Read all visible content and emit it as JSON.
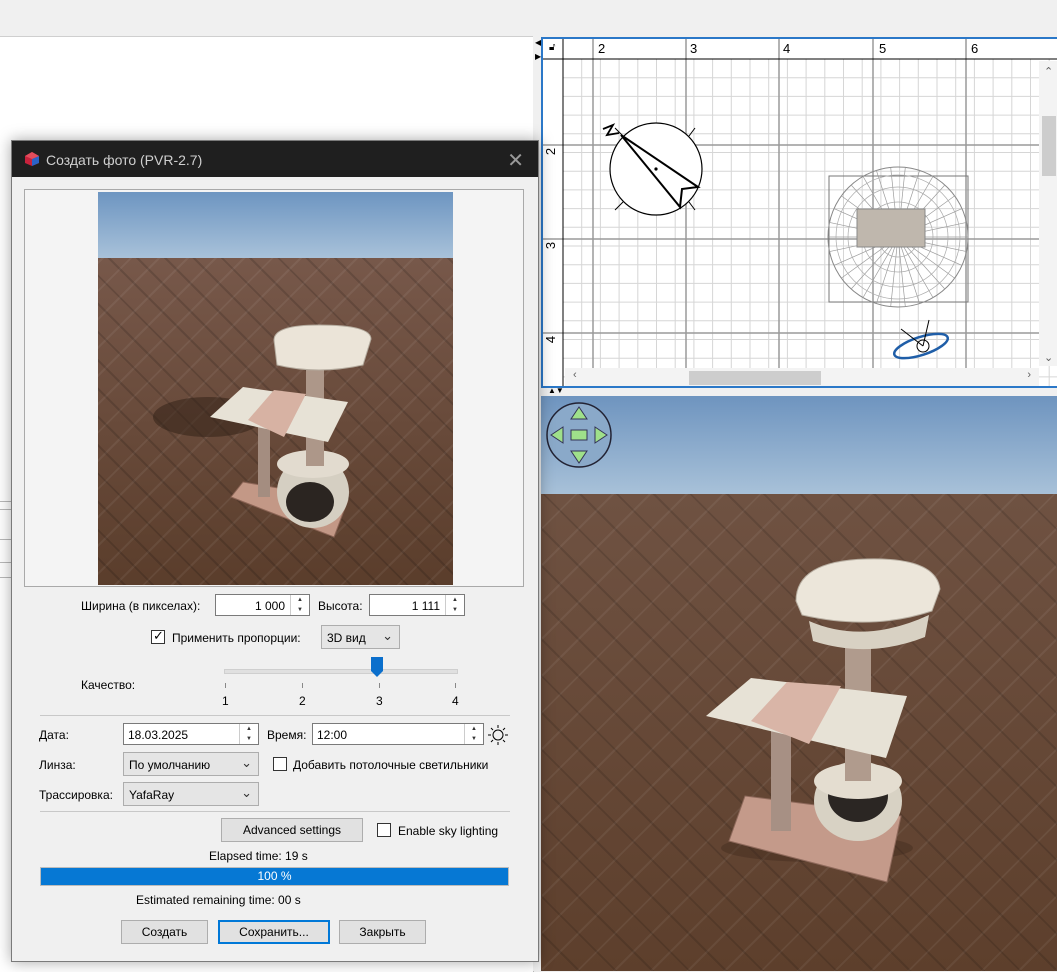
{
  "dialog": {
    "title": "Создать фото (PVR-2.7)",
    "width_label": "Ширина (в пикселах):",
    "width_value": "1 000",
    "height_label": "Высота:",
    "height_value": "1 111",
    "proportions_label": "Применить пропорции:",
    "proportions_checked": true,
    "view_mode": "3D вид",
    "quality_label": "Качество:",
    "quality_ticks": [
      "1",
      "2",
      "3",
      "4"
    ],
    "quality_value": 3,
    "date_label": "Дата:",
    "date_value": "18.03.2025",
    "time_label": "Время:",
    "time_value": "12:00",
    "lens_label": "Линза:",
    "lens_value": "По умолчанию",
    "ceiling_lights_label": "Добавить потолочные светильники",
    "ceiling_lights_checked": false,
    "tracing_label": "Трассировка:",
    "tracing_value": "YafaRay",
    "advanced_button": "Advanced settings",
    "sky_lighting_label": "Enable sky lighting",
    "sky_lighting_checked": false,
    "elapsed_label": "Elapsed time: 19 s",
    "progress_text": "100 %",
    "progress_value": 100,
    "remaining_label": "Estimated remaining time: 00 s",
    "create_button": "Создать",
    "save_button": "Сохранить...",
    "close_button": "Закрыть"
  },
  "plan": {
    "ruler_top": [
      "2",
      "3",
      "4",
      "5",
      "6"
    ],
    "ruler_left": [
      "2",
      "3",
      "4"
    ]
  },
  "colors": {
    "accent": "#2b78c8",
    "progress": "#0678d4",
    "titlebar": "#1f1f1f"
  }
}
